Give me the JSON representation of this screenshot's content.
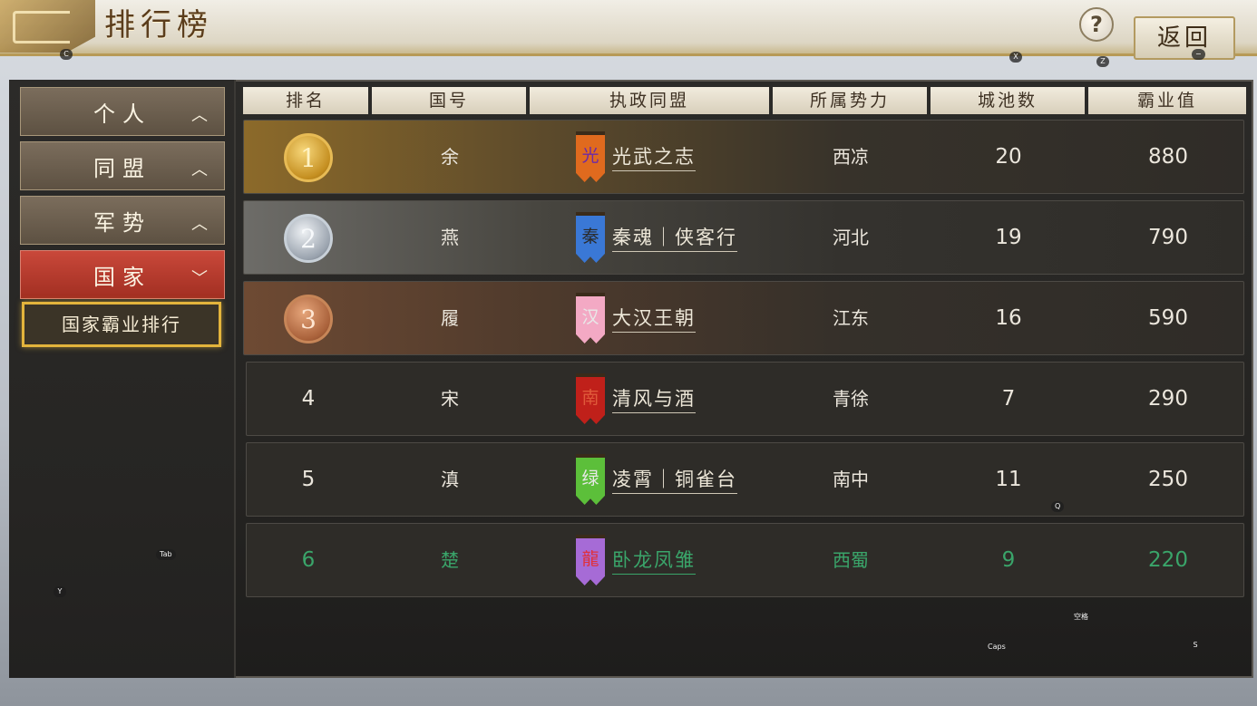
{
  "header": {
    "title": "排行榜",
    "help_label": "?",
    "back_label": "返回"
  },
  "key_hints": {
    "c": "C",
    "x": "X",
    "z": "Z",
    "minus": "−",
    "tab": "Tab",
    "y": "Y",
    "q": "Q",
    "space": "空格",
    "caps": "Caps",
    "s": "S"
  },
  "sidebar": {
    "items": [
      {
        "label": "个人",
        "chevron": "︿"
      },
      {
        "label": "同盟",
        "chevron": "︿"
      },
      {
        "label": "军势",
        "chevron": "︿"
      },
      {
        "label": "国家",
        "chevron": "﹀"
      }
    ],
    "sub_item": "国家霸业排行"
  },
  "table": {
    "columns": [
      "排名",
      "国号",
      "执政同盟",
      "所属势力",
      "城池数",
      "霸业值"
    ],
    "rows": [
      {
        "rank": "1",
        "country": "余",
        "banner_char": "光",
        "alliance": "光武之志",
        "faction": "西凉",
        "cities": "20",
        "value": "880",
        "banner_color": "#e06a1e",
        "banner_text": "#6b2aa8"
      },
      {
        "rank": "2",
        "country": "燕",
        "banner_char": "秦",
        "alliance": "秦魂｜侠客行",
        "faction": "河北",
        "cities": "19",
        "value": "790",
        "banner_color": "#3a78d6",
        "banner_text": "#2b2b2b"
      },
      {
        "rank": "3",
        "country": "履",
        "banner_char": "汉",
        "alliance": "大汉王朝",
        "faction": "江东",
        "cities": "16",
        "value": "590",
        "banner_color": "#f3a9c4",
        "banner_text": "#e8e8e8"
      },
      {
        "rank": "4",
        "country": "宋",
        "banner_char": "南",
        "alliance": "清风与酒",
        "faction": "青徐",
        "cities": "7",
        "value": "290",
        "banner_color": "#c0201a",
        "banner_text": "#e05a3a"
      },
      {
        "rank": "5",
        "country": "滇",
        "banner_char": "绿",
        "alliance": "凌霄｜铜雀台",
        "faction": "南中",
        "cities": "11",
        "value": "250",
        "banner_color": "#5cbf3a",
        "banner_text": "#e8e8e8"
      },
      {
        "rank": "6",
        "country": "楚",
        "banner_char": "龍",
        "alliance": "卧龙凤雏",
        "faction": "西蜀",
        "cities": "9",
        "value": "220",
        "banner_color": "#a66bd6",
        "banner_text": "#e0303a"
      }
    ]
  }
}
